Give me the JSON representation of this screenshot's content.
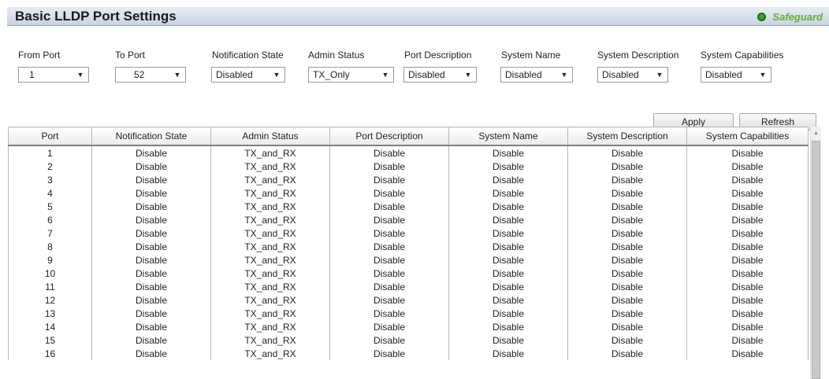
{
  "header": {
    "title": "Basic LLDP Port Settings",
    "safeguard_label": "Safeguard"
  },
  "controls": {
    "from_port": {
      "label": "From Port",
      "value": "1"
    },
    "to_port": {
      "label": "To Port",
      "value": "52"
    },
    "notification_state": {
      "label": "Notification State",
      "value": "Disabled"
    },
    "admin_status": {
      "label": "Admin Status",
      "value": "TX_Only"
    },
    "port_description": {
      "label": "Port Description",
      "value": "Disabled"
    },
    "system_name": {
      "label": "System Name",
      "value": "Disabled"
    },
    "system_description": {
      "label": "System Description",
      "value": "Disabled"
    },
    "system_capabilities": {
      "label": "System Capabilities",
      "value": "Disabled"
    },
    "apply_label": "Apply",
    "refresh_label": "Refresh"
  },
  "table": {
    "columns": [
      "Port",
      "Notification State",
      "Admin Status",
      "Port Description",
      "System Name",
      "System Description",
      "System Capabilities"
    ],
    "rows": [
      [
        "1",
        "Disable",
        "TX_and_RX",
        "Disable",
        "Disable",
        "Disable",
        "Disable"
      ],
      [
        "2",
        "Disable",
        "TX_and_RX",
        "Disable",
        "Disable",
        "Disable",
        "Disable"
      ],
      [
        "3",
        "Disable",
        "TX_and_RX",
        "Disable",
        "Disable",
        "Disable",
        "Disable"
      ],
      [
        "4",
        "Disable",
        "TX_and_RX",
        "Disable",
        "Disable",
        "Disable",
        "Disable"
      ],
      [
        "5",
        "Disable",
        "TX_and_RX",
        "Disable",
        "Disable",
        "Disable",
        "Disable"
      ],
      [
        "6",
        "Disable",
        "TX_and_RX",
        "Disable",
        "Disable",
        "Disable",
        "Disable"
      ],
      [
        "7",
        "Disable",
        "TX_and_RX",
        "Disable",
        "Disable",
        "Disable",
        "Disable"
      ],
      [
        "8",
        "Disable",
        "TX_and_RX",
        "Disable",
        "Disable",
        "Disable",
        "Disable"
      ],
      [
        "9",
        "Disable",
        "TX_and_RX",
        "Disable",
        "Disable",
        "Disable",
        "Disable"
      ],
      [
        "10",
        "Disable",
        "TX_and_RX",
        "Disable",
        "Disable",
        "Disable",
        "Disable"
      ],
      [
        "11",
        "Disable",
        "TX_and_RX",
        "Disable",
        "Disable",
        "Disable",
        "Disable"
      ],
      [
        "12",
        "Disable",
        "TX_and_RX",
        "Disable",
        "Disable",
        "Disable",
        "Disable"
      ],
      [
        "13",
        "Disable",
        "TX_and_RX",
        "Disable",
        "Disable",
        "Disable",
        "Disable"
      ],
      [
        "14",
        "Disable",
        "TX_and_RX",
        "Disable",
        "Disable",
        "Disable",
        "Disable"
      ],
      [
        "15",
        "Disable",
        "TX_and_RX",
        "Disable",
        "Disable",
        "Disable",
        "Disable"
      ],
      [
        "16",
        "Disable",
        "TX_and_RX",
        "Disable",
        "Disable",
        "Disable",
        "Disable"
      ]
    ]
  }
}
